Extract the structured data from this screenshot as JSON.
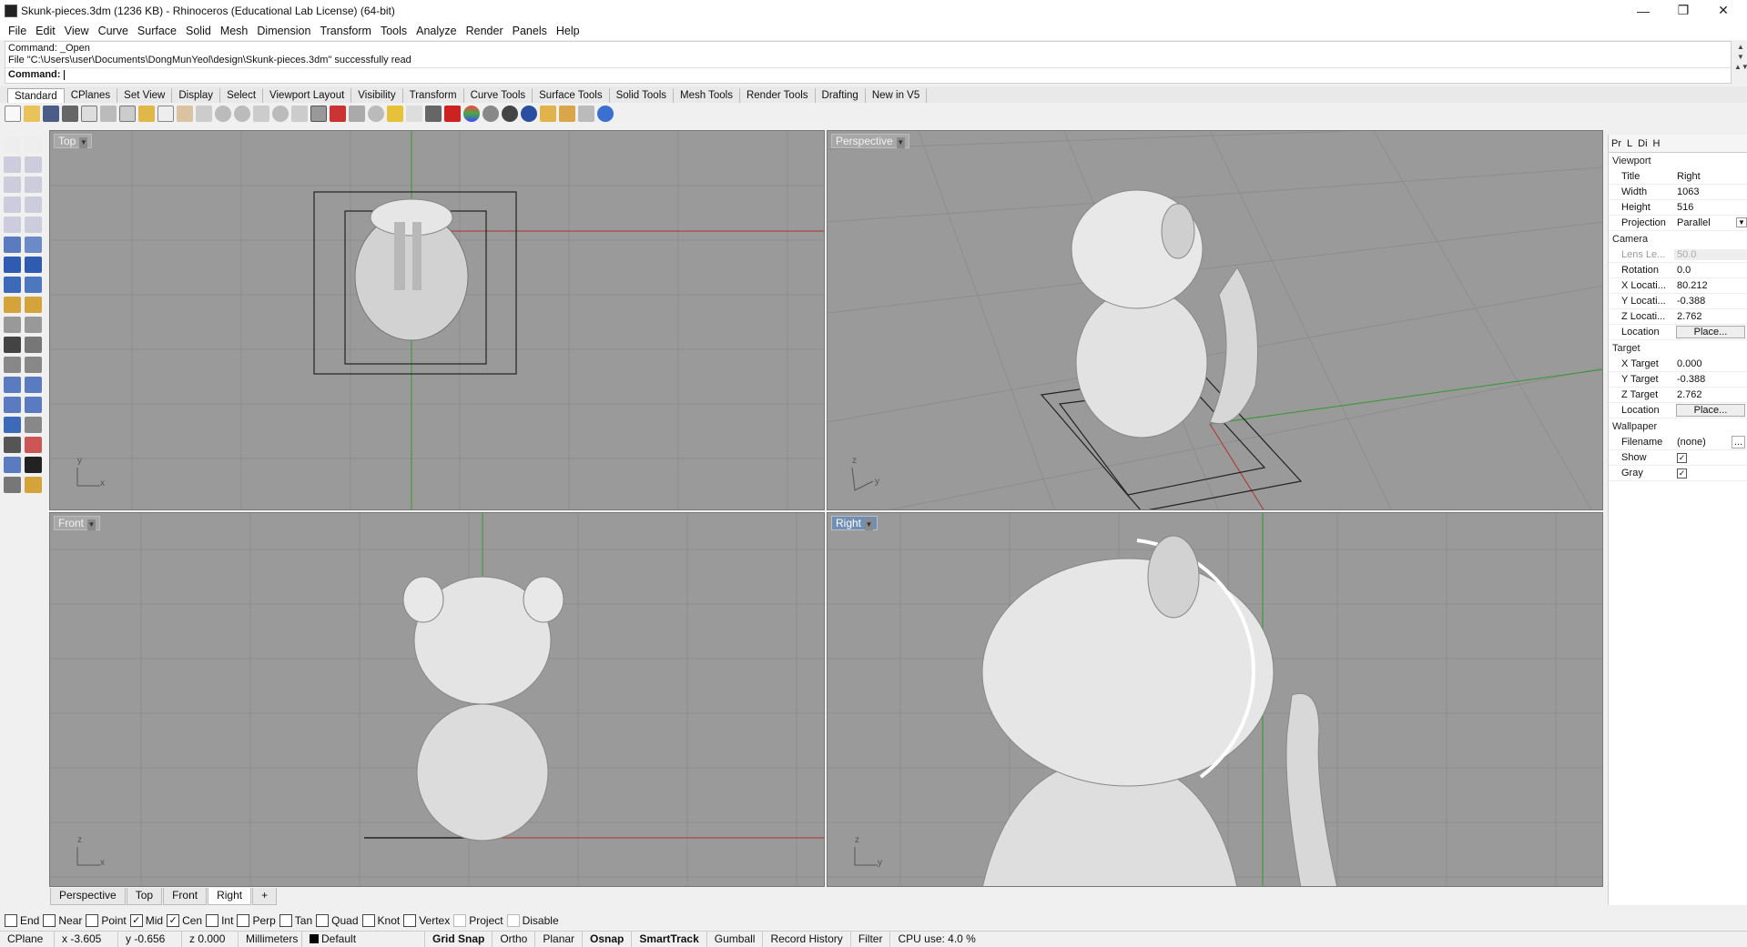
{
  "window": {
    "title": "Skunk-pieces.3dm (1236 KB) - Rhinoceros (Educational Lab License) (64-bit)"
  },
  "menu": [
    "File",
    "Edit",
    "View",
    "Curve",
    "Surface",
    "Solid",
    "Mesh",
    "Dimension",
    "Transform",
    "Tools",
    "Analyze",
    "Render",
    "Panels",
    "Help"
  ],
  "command": {
    "history1": "Command: _Open",
    "history2": "File \"C:\\Users\\user\\Documents\\DongMunYeol\\design\\Skunk-pieces.3dm\" successfully read",
    "prompt": "Command:"
  },
  "toolbar_tabs": [
    "Standard",
    "CPlanes",
    "Set View",
    "Display",
    "Select",
    "Viewport Layout",
    "Visibility",
    "Transform",
    "Curve Tools",
    "Surface Tools",
    "Solid Tools",
    "Mesh Tools",
    "Render Tools",
    "Drafting",
    "New in V5"
  ],
  "viewports": {
    "top": "Top",
    "perspective": "Perspective",
    "front": "Front",
    "right": "Right"
  },
  "viewport_tabs": [
    "Perspective",
    "Top",
    "Front",
    "Right"
  ],
  "panel": {
    "tabs": [
      "Pr",
      "L",
      "Di",
      "H"
    ],
    "viewport_section": "Viewport",
    "title_k": "Title",
    "title_v": "Right",
    "width_k": "Width",
    "width_v": "1063",
    "height_k": "Height",
    "height_v": "516",
    "proj_k": "Projection",
    "proj_v": "Parallel",
    "camera_section": "Camera",
    "lens_k": "Lens Le...",
    "lens_v": "50.0",
    "rot_k": "Rotation",
    "rot_v": "0.0",
    "xloc_k": "X Locati...",
    "xloc_v": "80.212",
    "yloc_k": "Y Locati...",
    "yloc_v": "-0.388",
    "zloc_k": "Z Locati...",
    "zloc_v": "2.762",
    "loc_k": "Location",
    "place": "Place...",
    "target_section": "Target",
    "xt_k": "X Target",
    "xt_v": "0.000",
    "yt_k": "Y Target",
    "yt_v": "-0.388",
    "zt_k": "Z Target",
    "zt_v": "2.762",
    "tloc_k": "Location",
    "wall_section": "Wallpaper",
    "fn_k": "Filename",
    "fn_v": "(none)",
    "fn_btn": "...",
    "show_k": "Show",
    "gray_k": "Gray"
  },
  "osnap": [
    {
      "label": "End",
      "checked": false
    },
    {
      "label": "Near",
      "checked": false
    },
    {
      "label": "Point",
      "checked": false
    },
    {
      "label": "Mid",
      "checked": true
    },
    {
      "label": "Cen",
      "checked": true
    },
    {
      "label": "Int",
      "checked": false
    },
    {
      "label": "Perp",
      "checked": false
    },
    {
      "label": "Tan",
      "checked": false
    },
    {
      "label": "Quad",
      "checked": false
    },
    {
      "label": "Knot",
      "checked": false
    },
    {
      "label": "Vertex",
      "checked": false
    },
    {
      "label": "Project",
      "checked": false
    },
    {
      "label": "Disable",
      "checked": false
    }
  ],
  "status": {
    "cplane": "CPlane",
    "x": "x -3.605",
    "y": "y -0.656",
    "z": "z 0.000",
    "units": "Millimeters",
    "layer": "Default",
    "grid": "Grid Snap",
    "ortho": "Ortho",
    "planar": "Planar",
    "osnap": "Osnap",
    "smart": "SmartTrack",
    "gumball": "Gumball",
    "record": "Record History",
    "filter": "Filter",
    "cpu": "CPU use: 4.0 %"
  },
  "colors": {
    "viewport_bg": "#9a9a9a",
    "x_axis": "#b03030",
    "y_axis": "#2f9a2f",
    "active_label": "#6f8fb7"
  }
}
